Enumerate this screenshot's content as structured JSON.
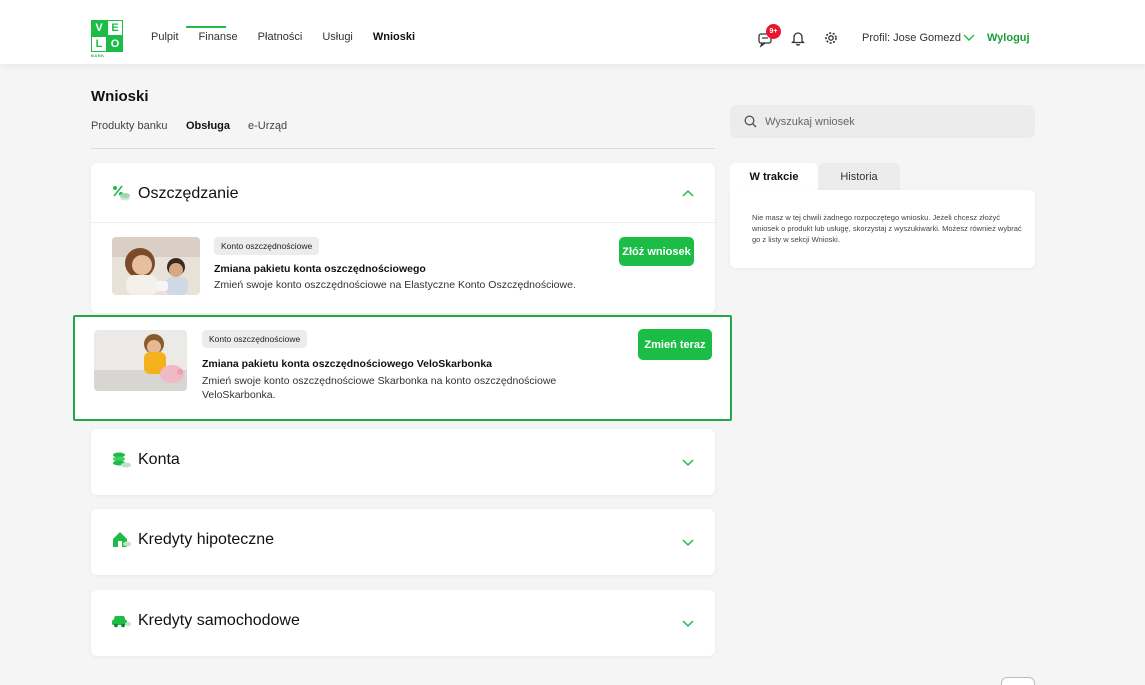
{
  "brand": {
    "logo_letters": [
      "V",
      "E",
      "L",
      "O"
    ],
    "logo_sub": "BANK",
    "accent": "#1bbd47"
  },
  "nav": {
    "items": [
      "Pulpit",
      "Finanse",
      "Płatności",
      "Usługi",
      "Wnioski"
    ],
    "active": "Wnioski"
  },
  "header": {
    "messages_badge": "9+",
    "profile_label": "Profil: Jose Gomezd",
    "logout_label": "Wyloguj"
  },
  "page": {
    "title": "Wnioski",
    "tabs": [
      "Produkty banku",
      "Obsługa",
      "e-Urząd"
    ],
    "active_tab": "Obsługa"
  },
  "search": {
    "placeholder": "Wyszukaj wniosek"
  },
  "sections": {
    "savings": {
      "title": "Oszczędzanie",
      "expanded": true,
      "offers": [
        {
          "tag": "Konto oszczędnościowe",
          "title": "Zmiana pakietu konta oszczędnościowego",
          "desc": "Zmień swoje konto oszczędnościowe na Elastyczne Konto Oszczędnościowe.",
          "button": "Złóż wniosek"
        },
        {
          "tag": "Konto oszczędnościowe",
          "title": "Zmiana pakietu konta oszczędnościowego VeloSkarbonka",
          "desc": "Zmień swoje konto oszczędnościowe Skarbonka na konto oszczędnościowe VeloSkarbonka.",
          "button": "Zmień teraz",
          "highlighted": true
        }
      ]
    },
    "accounts": {
      "title": "Konta"
    },
    "mortgage": {
      "title": "Kredyty hipoteczne"
    },
    "car_loans": {
      "title": "Kredyty samochodowe"
    }
  },
  "side": {
    "tabs": [
      "W trakcie",
      "Historia"
    ],
    "active_tab": "W trakcie",
    "empty_text": "Nie masz w tej chwili żadnego rozpoczętego wniosku. Jeżeli chcesz złożyć wniosek o produkt lub usługę, skorzystaj z wyszukiwarki. Możesz również wybrać go z listy w sekcji Wnioski."
  },
  "icons": [
    "chat-icon",
    "bell-icon",
    "gear-icon",
    "chevron-down-icon",
    "search-icon",
    "percent-coins-icon",
    "coins-icon",
    "house-icon",
    "car-icon",
    "chevron-up-icon"
  ]
}
